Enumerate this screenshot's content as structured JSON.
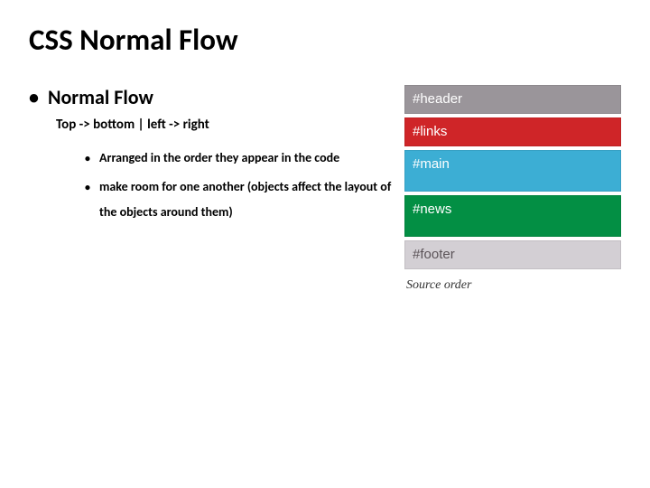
{
  "title": "CSS Normal Flow",
  "bullets": {
    "lvl1": "Normal Flow",
    "lvl2": "Top -> bottom | left -> right",
    "lvl3a": "Arranged in the order they appear in the code",
    "lvl3b": "make room for one another (objects affect the layout of the objects around them)"
  },
  "diagram": {
    "header": "#header",
    "links": "#links",
    "main": "#main",
    "news": "#news",
    "footer": "#footer",
    "caption": "Source order"
  }
}
